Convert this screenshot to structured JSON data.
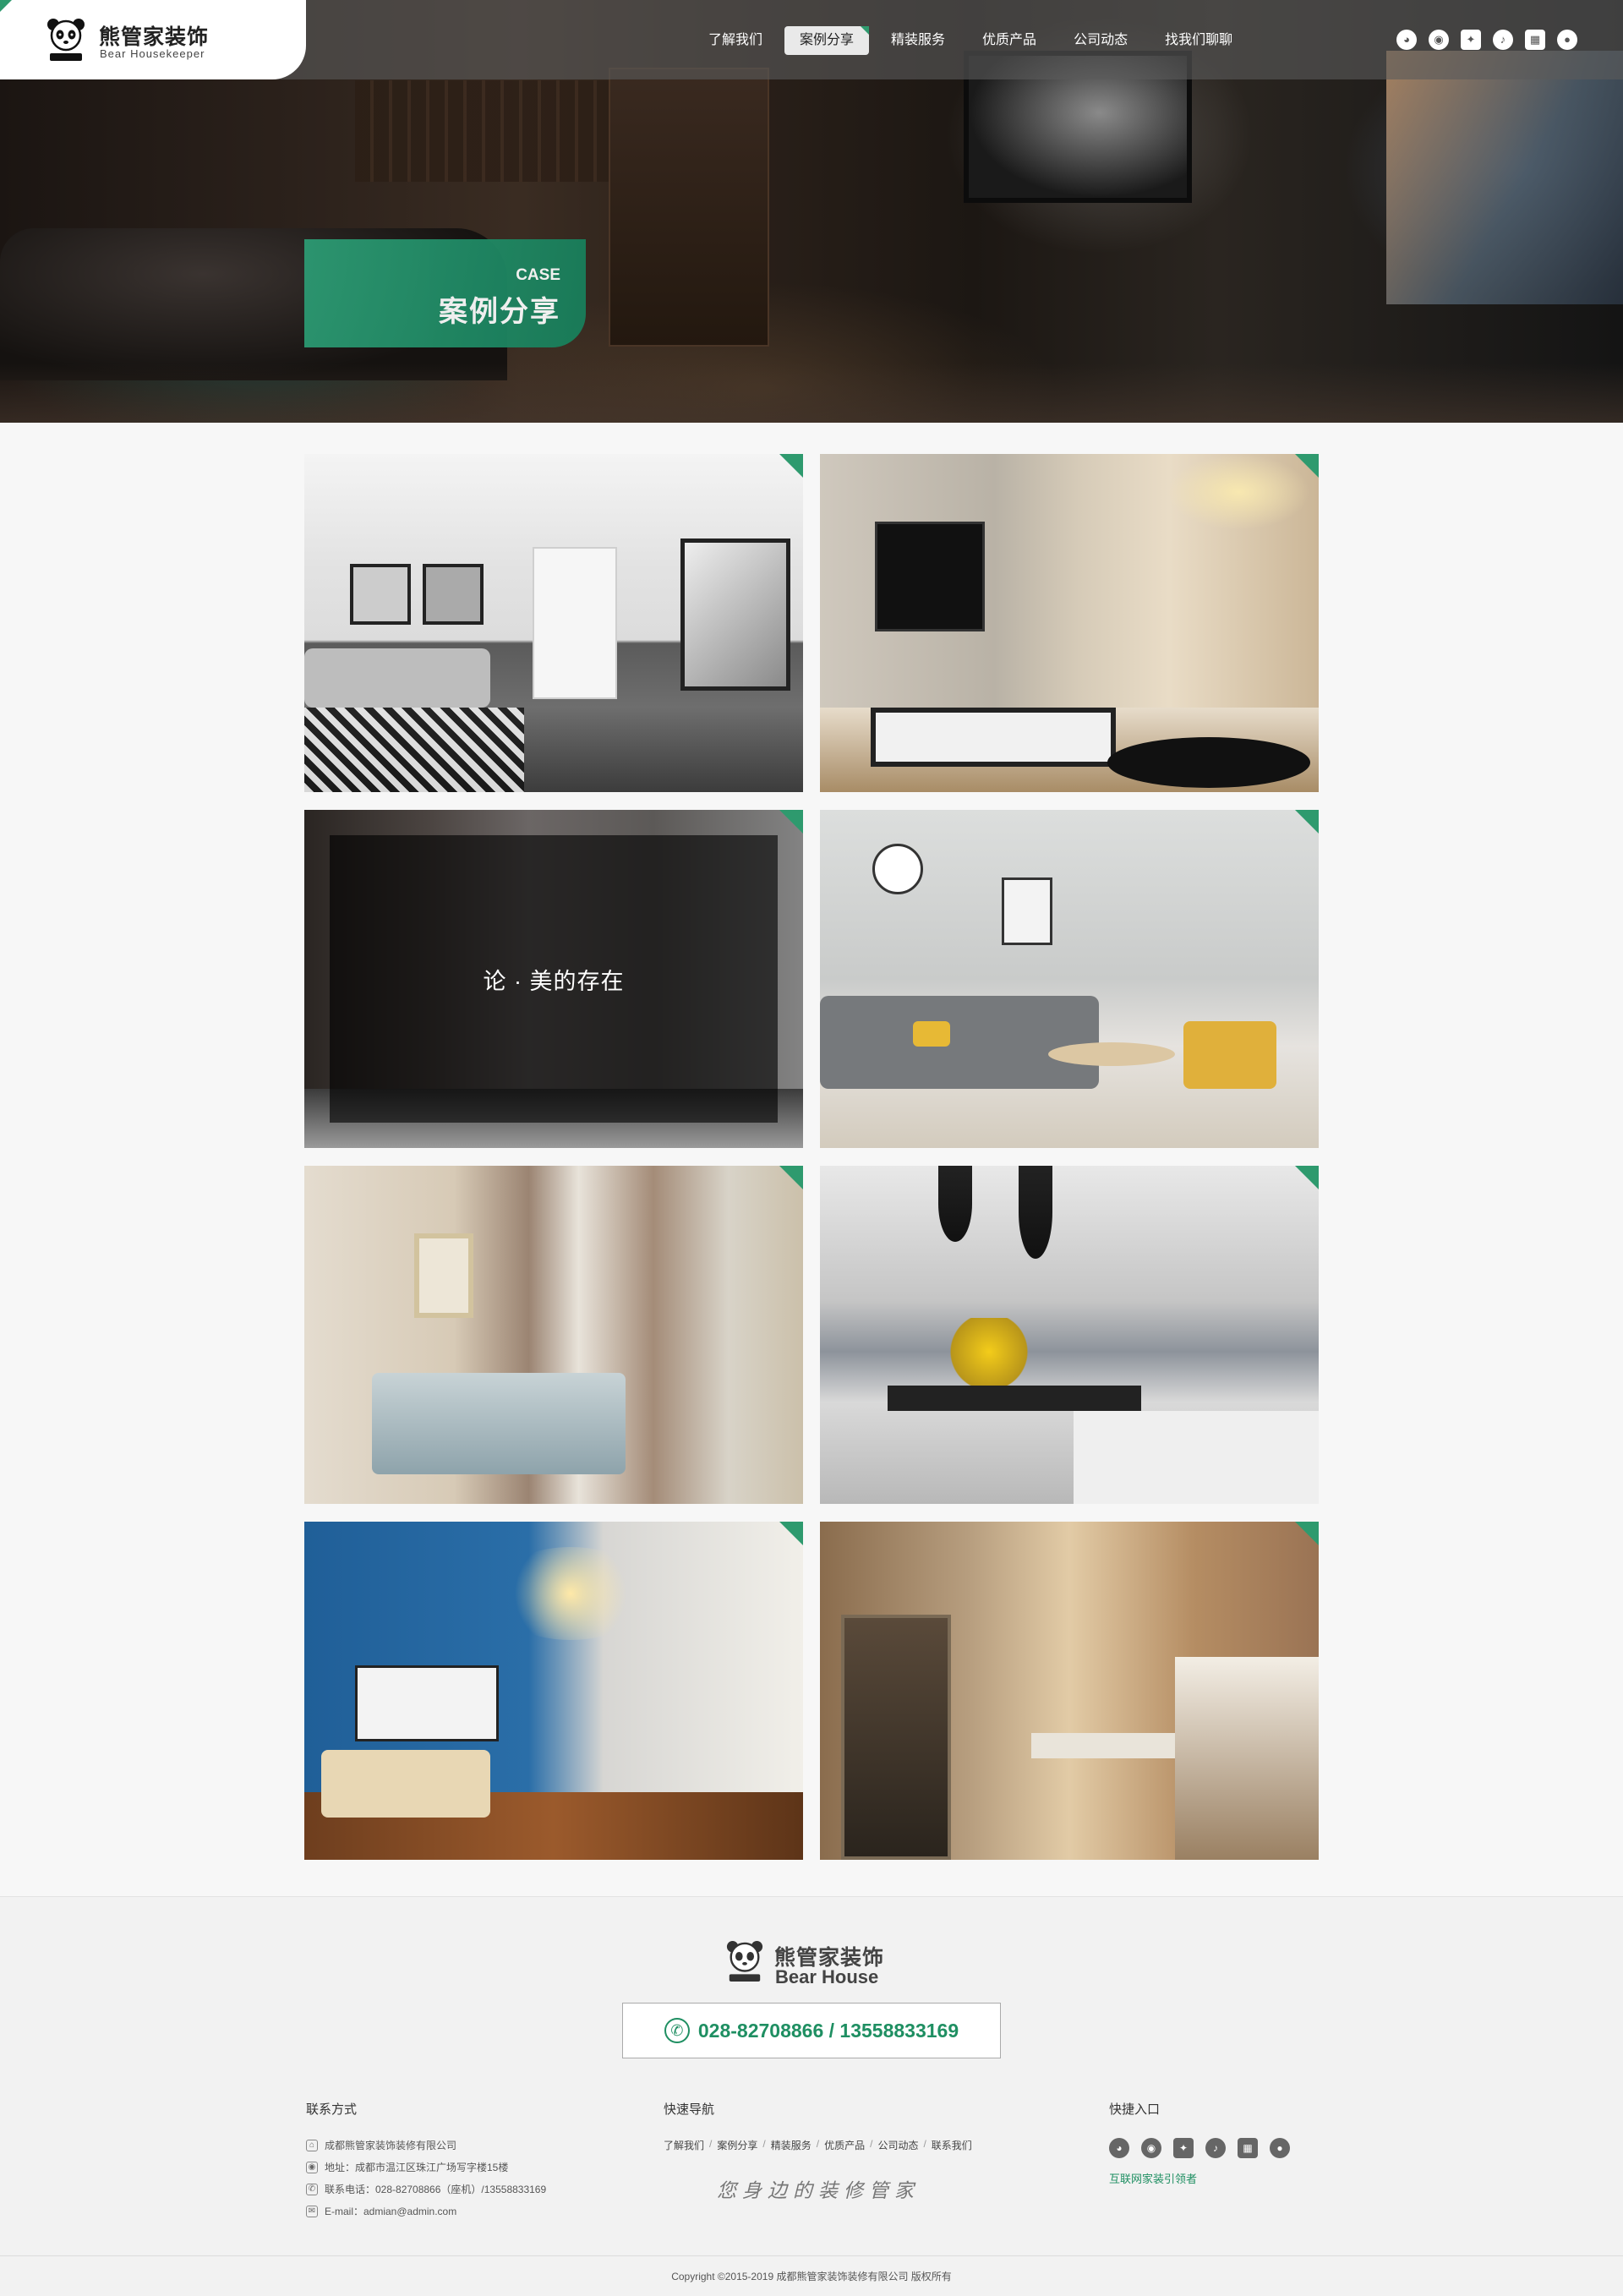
{
  "brand": {
    "name_cn": "熊管家装饰",
    "name_en": "Bear Housekeeper",
    "panda_caption": "熊管家装饰"
  },
  "nav": {
    "items": [
      "了解我们",
      "案例分享",
      "精装服务",
      "优质产品",
      "公司动态",
      "找我们聊聊"
    ],
    "active_index": 1
  },
  "social": [
    "wechat-icon",
    "weibo-icon",
    "app-icon",
    "douyin-icon",
    "qr-icon",
    "bear-icon"
  ],
  "hero": {
    "case_en": "CASE",
    "case_cn": "案例分享"
  },
  "cases": [
    {
      "overlay": ""
    },
    {
      "overlay": ""
    },
    {
      "overlay": "论 · 美的存在"
    },
    {
      "overlay": ""
    },
    {
      "overlay": ""
    },
    {
      "overlay": ""
    },
    {
      "overlay": ""
    },
    {
      "overlay": ""
    }
  ],
  "footer": {
    "logo_cn": "熊管家装饰",
    "logo_en": "Bear House",
    "phone": "028-82708866 / 13558833169",
    "contact": {
      "title": "联系方式",
      "company": "成都熊管家装饰装修有限公司",
      "address": "地址：成都市温江区珠江广场写字楼15楼",
      "tel": "联系电话：028-82708866（座机）/13558833169",
      "email": "E-mail：admian@admin.com"
    },
    "quick_nav": {
      "title": "快速导航",
      "links": [
        "了解我们",
        "案例分享",
        "精装服务",
        "优质产品",
        "公司动态",
        "联系我们"
      ],
      "slogan": "您身边的装修管家"
    },
    "quick_entry": {
      "title": "快捷入口",
      "lead": "互联网家装引领者"
    },
    "copyright": "Copyright ©2015-2019   成都熊管家装饰装修有限公司 版权所有"
  },
  "colors": {
    "accent": "#2e9a6e",
    "accent_dark": "#1f8f62",
    "topbar": "rgba(90,90,90,0.62)"
  }
}
